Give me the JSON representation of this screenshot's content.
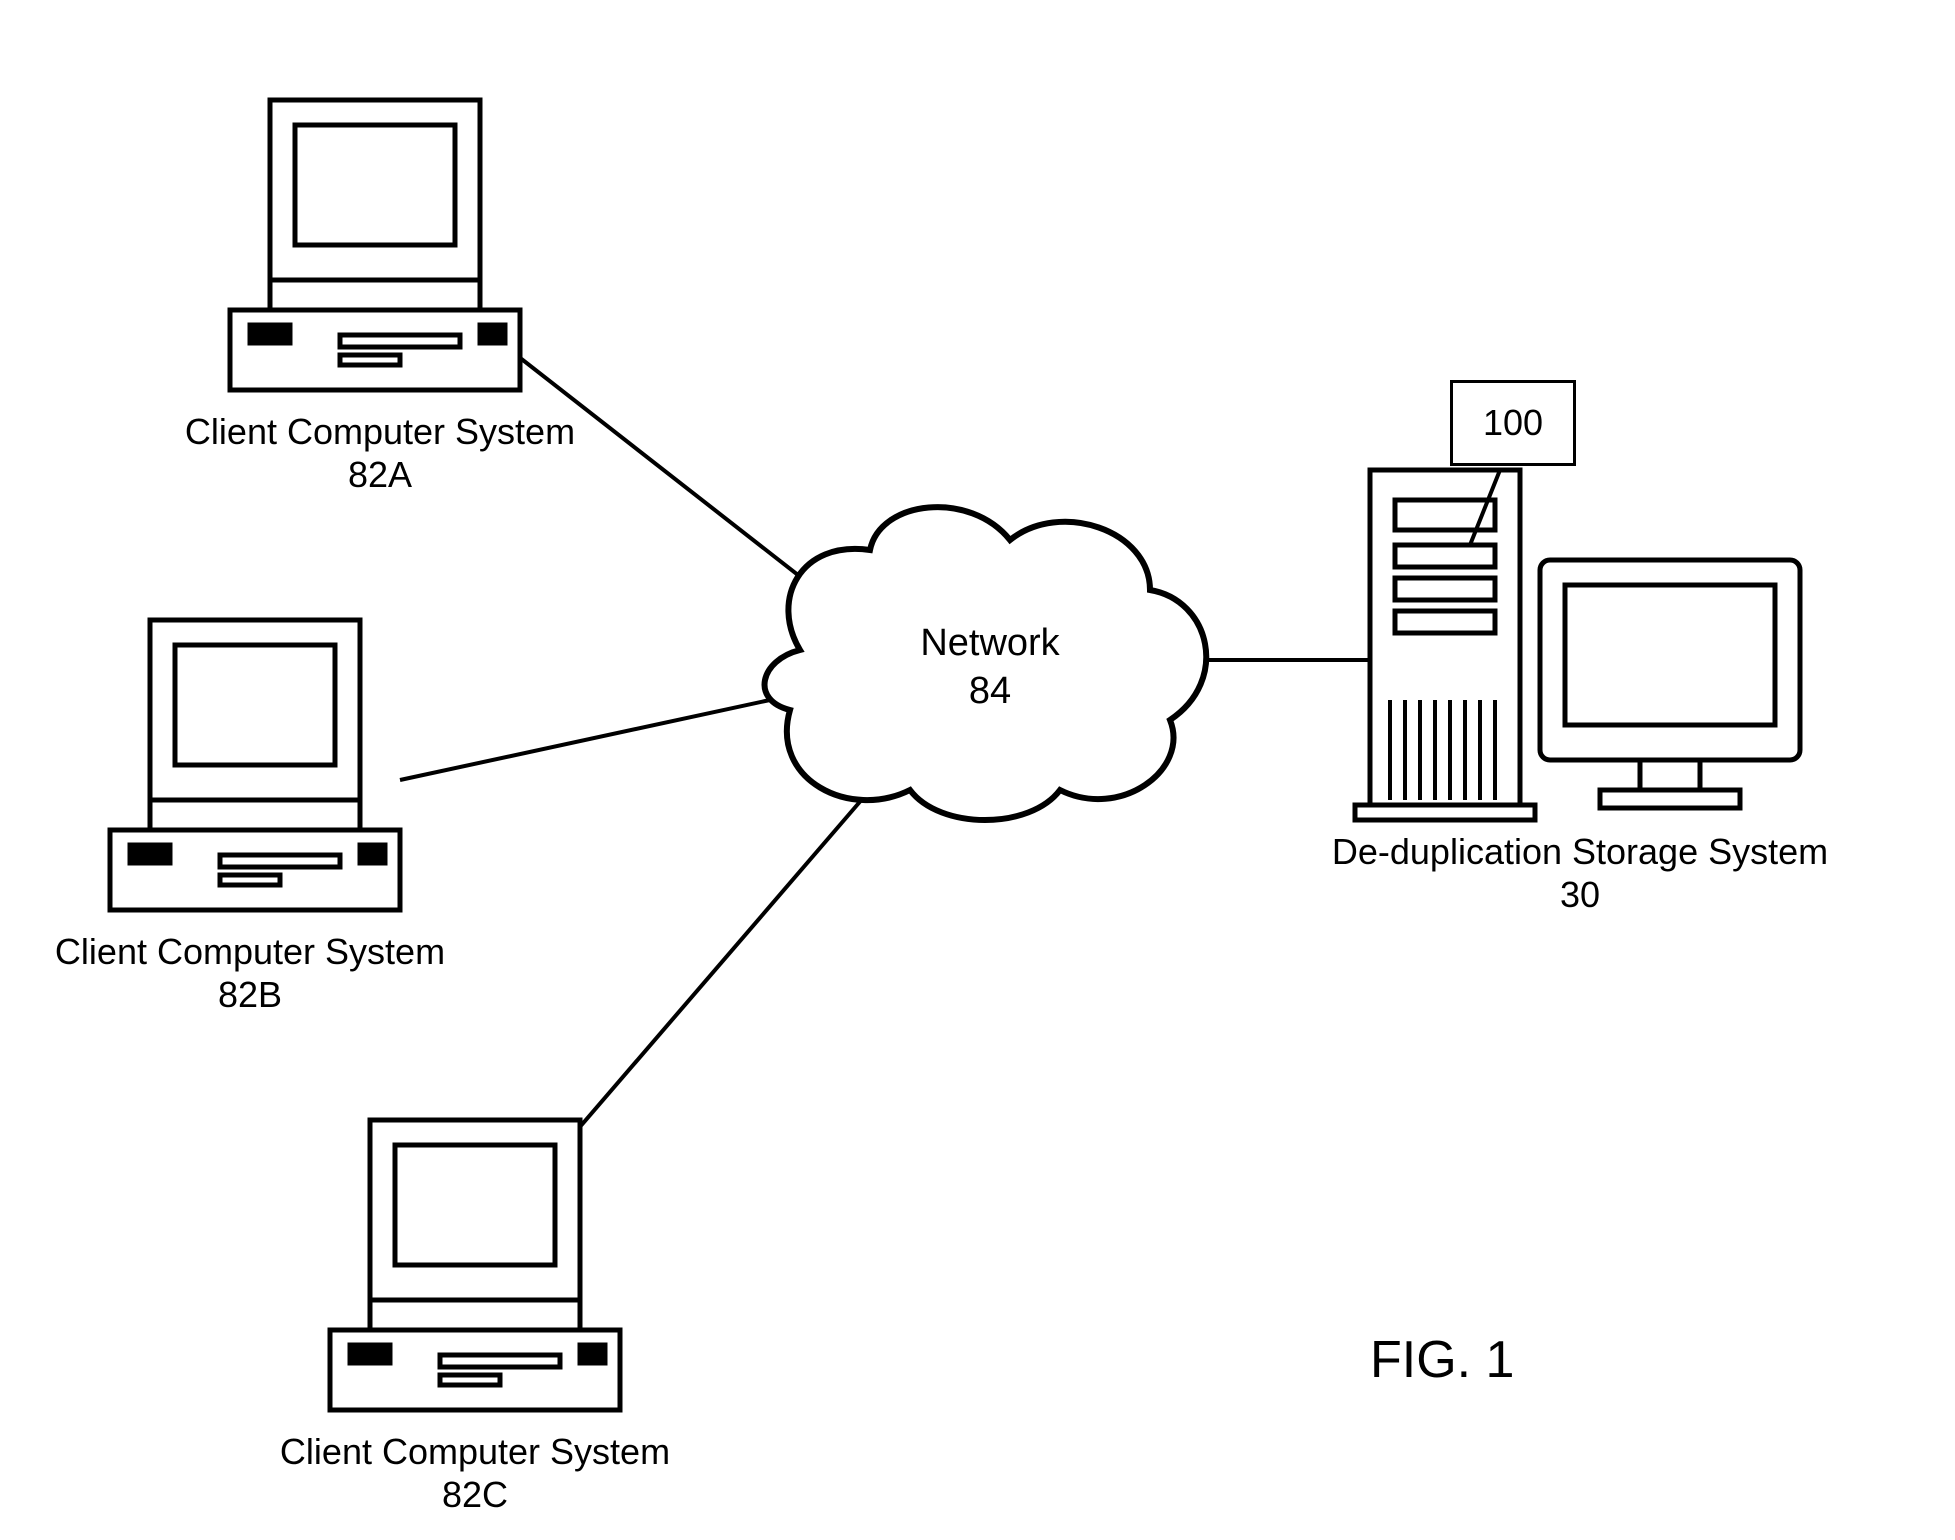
{
  "nodes": {
    "clientA": {
      "label_line1": "Client Computer System",
      "label_line2": "82A"
    },
    "clientB": {
      "label_line1": "Client Computer System",
      "label_line2": "82B"
    },
    "clientC": {
      "label_line1": "Client Computer System",
      "label_line2": "82C"
    },
    "server": {
      "label_line1": "De-duplication Storage System",
      "label_line2": "30"
    },
    "network": {
      "label_line1": "Network",
      "label_line2": "84"
    }
  },
  "callout": {
    "label": "100"
  },
  "figure": {
    "label": "FIG. 1"
  },
  "diagram_data": {
    "type": "network-topology",
    "nodes": [
      {
        "id": "82A",
        "kind": "client-computer",
        "title": "Client Computer System 82A"
      },
      {
        "id": "82B",
        "kind": "client-computer",
        "title": "Client Computer System 82B"
      },
      {
        "id": "82C",
        "kind": "client-computer",
        "title": "Client Computer System 82C"
      },
      {
        "id": "84",
        "kind": "network-cloud",
        "title": "Network 84"
      },
      {
        "id": "30",
        "kind": "server-storage",
        "title": "De-duplication Storage System 30"
      }
    ],
    "edges": [
      {
        "from": "82A",
        "to": "84"
      },
      {
        "from": "82B",
        "to": "84"
      },
      {
        "from": "82C",
        "to": "84"
      },
      {
        "from": "84",
        "to": "30"
      }
    ],
    "callouts": [
      {
        "id": "100",
        "points_to_node": "30"
      }
    ]
  }
}
